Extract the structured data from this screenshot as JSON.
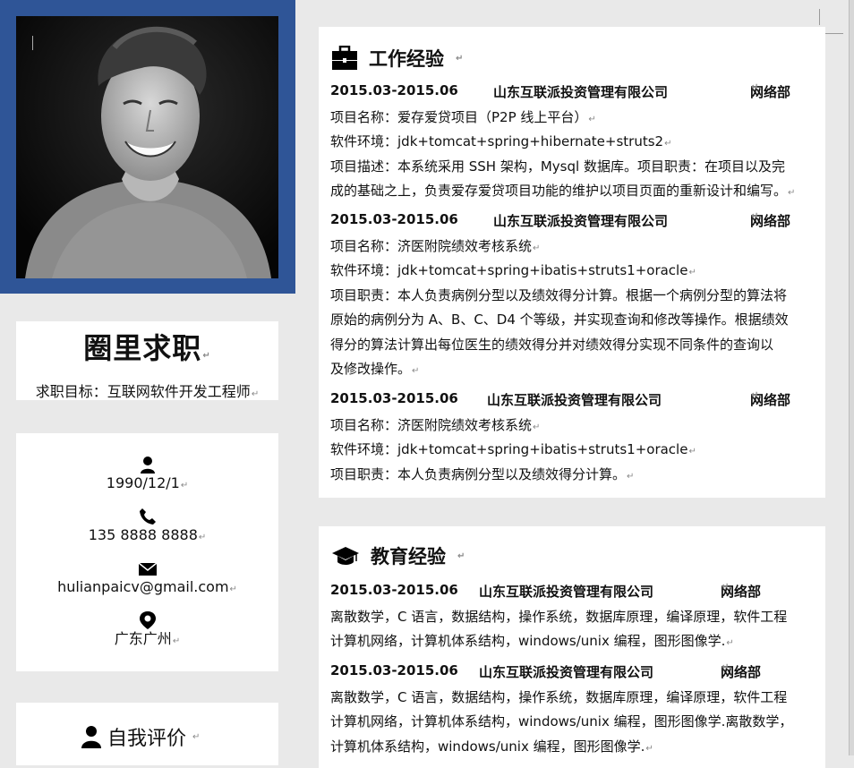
{
  "sidebar": {
    "name": "圈里求职",
    "target": "求职目标：互联网软件开发工程师",
    "contacts": [
      {
        "icon": "user-icon",
        "text": "1990/12/1"
      },
      {
        "icon": "phone-icon",
        "text": "135 8888 8888"
      },
      {
        "icon": "envelope-icon",
        "text": "hulianpaicv@gmail.com"
      },
      {
        "icon": "location-pin-icon",
        "text": "广东广州"
      }
    ],
    "self_eval_title": "自我评价"
  },
  "work": {
    "title": "工作经验",
    "entries": [
      {
        "dates": "2015.03-2015.06",
        "company": "山东互联派投资管理有限公司",
        "dept": "网络部",
        "lines": [
          "项目名称：爱存爱贷项目（P2P 线上平台）",
          "软件环境：jdk+tomcat+spring+hibernate+struts2",
          "项目描述：本系统采用 SSH 架构，Mysql 数据库。项目职责：在项目以及完",
          "成的基础之上，负责爱存爱贷项目功能的维护以项目页面的重新设计和编写。"
        ]
      },
      {
        "dates": "2015.03-2015.06",
        "company": "山东互联派投资管理有限公司",
        "dept": "网络部",
        "lines": [
          "项目名称：济医附院绩效考核系统",
          "软件环境：jdk+tomcat+spring+ibatis+struts1+oracle",
          "项目职责：本人负责病例分型以及绩效得分计算。根据一个病例分型的算法将",
          "原始的病例分为 A、B、C、D4 个等级，并实现查询和修改等操作。根据绩效",
          "得分的算法计算出每位医生的绩效得分并对绩效得分实现不同条件的查询以",
          "及修改操作。"
        ]
      },
      {
        "dates": "2015.03-2015.06",
        "company": "山东互联派投资管理有限公司",
        "dept": "网络部",
        "lines": [
          "项目名称：济医附院绩效考核系统",
          "软件环境：jdk+tomcat+spring+ibatis+struts1+oracle",
          "项目职责：本人负责病例分型以及绩效得分计算。"
        ]
      }
    ]
  },
  "education": {
    "title": "教育经验",
    "entries": [
      {
        "dates": "2015.03-2015.06",
        "company": "山东互联派投资管理有限公司",
        "dept": "网络部",
        "lines": [
          "离散数学，C 语言，数据结构，操作系统，数据库原理，编译原理，软件工程",
          "计算机网络，计算机体系结构，windows/unix 编程，图形图像学."
        ]
      },
      {
        "dates": "2015.03-2015.06",
        "company": "山东互联派投资管理有限公司",
        "dept": "网络部",
        "lines": [
          "离散数学，C 语言，数据结构，操作系统，数据库原理，编译原理，软件工程",
          "计算机网络，计算机体系结构，windows/unix 编程，图形图像学.离散数学，",
          "计算机体系结构，windows/unix 编程，图形图像学."
        ]
      }
    ]
  },
  "colors": {
    "frame_blue": "#2f5597",
    "page_gray": "#e9e9e9"
  }
}
